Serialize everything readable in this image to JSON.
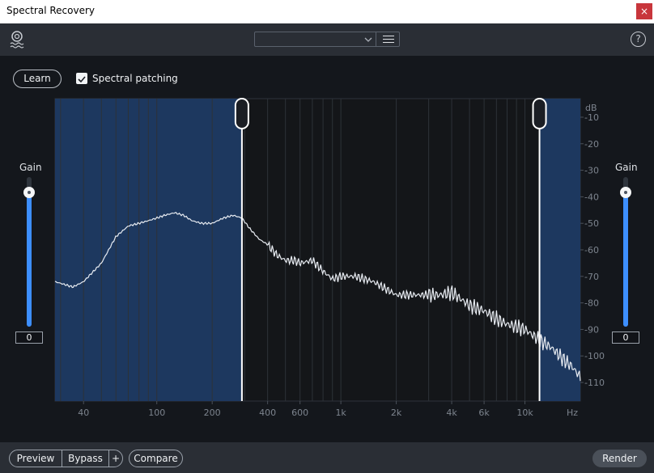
{
  "window": {
    "title": "Spectral Recovery",
    "close_label": "×"
  },
  "toolbar": {
    "preset_value": "",
    "help_label": "?"
  },
  "controls": {
    "learn_label": "Learn",
    "spectral_patching_label": "Spectral patching",
    "spectral_patching_checked": true
  },
  "gain_left": {
    "label": "Gain",
    "value": "0"
  },
  "gain_right": {
    "label": "Gain",
    "value": "0"
  },
  "spectrum": {
    "db_unit": "dB",
    "db_ticks": [
      "-10",
      "-20",
      "-30",
      "-40",
      "-50",
      "-60",
      "-70",
      "-80",
      "-90",
      "-100",
      "-110"
    ],
    "freq_unit": "Hz",
    "freq_ticks": [
      "40",
      "100",
      "200",
      "400",
      "600",
      "1k",
      "2k",
      "4k",
      "6k",
      "10k"
    ],
    "band_start_hz": 290,
    "band_end_hz": 12000
  },
  "bottom": {
    "preview_label": "Preview",
    "bypass_label": "Bypass",
    "plus_label": "+",
    "compare_label": "Compare",
    "render_label": "Render"
  },
  "colors": {
    "accent": "#3d8fff",
    "band_fill": "#1e3a63",
    "background": "#14171c",
    "render_button": "#4a5059"
  }
}
